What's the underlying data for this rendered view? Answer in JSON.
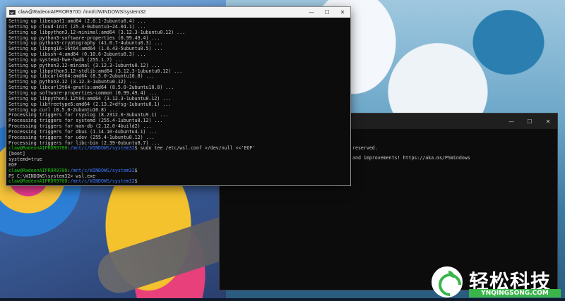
{
  "front_window": {
    "title": "claw@RadeonAIPROR9700: /mnt/c/WINDOWS/system32",
    "controls": {
      "minimize": "—",
      "maximize": "☐",
      "close": "✕"
    },
    "lines": [
      {
        "text": "Setting up libexpat1:amd64 (2.6.1-2ubuntu0.4) ..."
      },
      {
        "text": "Setting up cloud-init (25.3-0ubuntu1~24.04.1) ..."
      },
      {
        "text": "Setting up libpython3.12-minimal:amd64 (3.12.3-1ubuntu0.12) ..."
      },
      {
        "text": "Setting up python3-software-properties (0.99.49.4) ..."
      },
      {
        "text": "Setting up python3-cryptography (41.0.7-4ubuntu0.3) ..."
      },
      {
        "text": "Setting up libpng16-16t64:amd64 (1.6.43-5ubuntu0.5) ..."
      },
      {
        "text": "Setting up libssh-4:amd64 (0.10.6-2ubuntu0.3) ..."
      },
      {
        "text": "Setting up systemd-hwe-hwdb (255.1.7) ..."
      },
      {
        "text": "Setting up python3.12-minimal (3.12.3-1ubuntu0.12) ..."
      },
      {
        "text": "Setting up libpython3.12-stdlib:amd64 (3.12.3-1ubuntu0.12) ..."
      },
      {
        "text": "Setting up libcurl4t64:amd64 (8.5.0-2ubuntu10.8) ..."
      },
      {
        "text": "Setting up python3.12 (3.12.3-1ubuntu0.12) ..."
      },
      {
        "text": "Setting up libcurl3t64-gnutls:amd64 (8.5.0-2ubuntu10.8) ..."
      },
      {
        "text": "Setting up software-properties-common (0.99.49.4) ..."
      },
      {
        "text": "Setting up libpython3.12t64:amd64 (3.12.3-1ubuntu0.12) ..."
      },
      {
        "text": "Setting up libfreetype6:amd64 (2.13.2+dfsg-1ubuntu0.1) ..."
      },
      {
        "text": "Setting up curl (8.5.0-2ubuntu10.8) ..."
      },
      {
        "text": "Processing triggers for rsyslog (8.2312.0-3ubuntu9.1) ..."
      },
      {
        "text": "Processing triggers for systemd (255.4-1ubuntu8.12) ..."
      },
      {
        "text": "Processing triggers for man-db (2.12.0-4build2) ..."
      },
      {
        "text": "Processing triggers for dbus (1.14.10-4ubuntu4.1) ..."
      },
      {
        "text": "Processing triggers for udev (255.4-1ubuntu8.12) ..."
      },
      {
        "text": "Processing triggers for libc-bin (2.39-0ubuntu8.7) ..."
      },
      {
        "prompt_user": "claw@RadeonAIPROR9700",
        "prompt_sep": ":",
        "prompt_path": "/mnt/c/WINDOWS/system32",
        "prompt_end": "$",
        "text": " sudo tee /etc/wsl.conf >/dev/null <<'EOF'"
      },
      {
        "text": "[boot]"
      },
      {
        "text": "systemd=true"
      },
      {
        "text": "EOF"
      },
      {
        "prompt_user": "claw@RadeonAIPROR9700",
        "prompt_sep": ":",
        "prompt_path": "/mnt/c/WINDOWS/system32",
        "prompt_end": "$",
        "text": ""
      },
      {
        "text": "PS C:\\WINDOWS\\system32> wsl.exe"
      },
      {
        "prompt_user": "claw@RadeonAIPROR9700",
        "prompt_sep": ":",
        "prompt_path": "/mnt/c/WINDOWS/system32",
        "prompt_end": "$",
        "text": ""
      }
    ]
  },
  "back_window": {
    "controls": {
      "minimize": "—",
      "maximize": "☐",
      "close": "✕"
    },
    "lines": [
      "reserved.",
      "and improvements! https://aka.ms/PSWindows"
    ]
  },
  "watermark": {
    "brand_cn": "轻松科技",
    "brand_en": "YNQINGSONG.COM"
  }
}
